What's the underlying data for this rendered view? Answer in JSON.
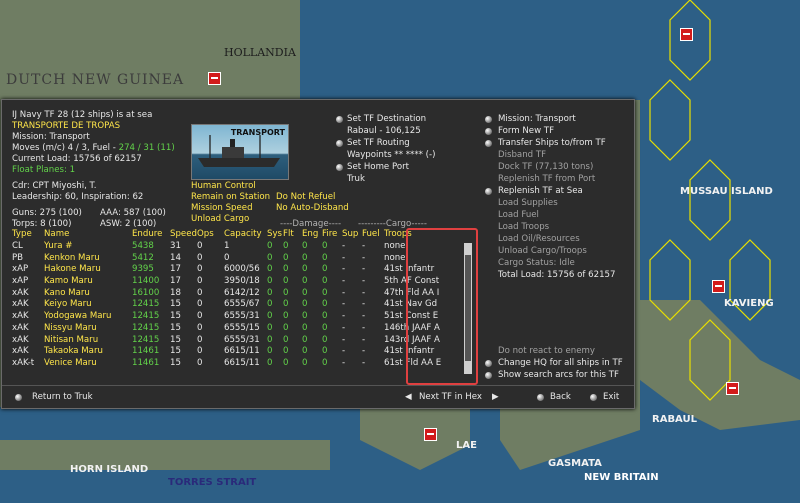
{
  "map": {
    "labels": {
      "hollandia": "HOLLANDIA",
      "dutch_new_guinea": "DUTCH NEW GUINEA",
      "mussau": "MUSSAU ISLAND",
      "kavieng": "KAVIENG",
      "rabaul": "RABAUL",
      "lae": "LAE",
      "gasmata": "GASMATA",
      "new_britain": "NEW BRITAIN",
      "horn_island": "HORN ISLAND",
      "torres_strait": "TORRES STRAIT"
    },
    "colors": {
      "sea": "#2d5f86",
      "land": "#6f7d63",
      "hex_line": "#e8e000",
      "marker": "#d21b1b"
    }
  },
  "tf": {
    "header": "IJ Navy TF 28 (12 ships) is at sea",
    "name": "TRANSPORTE DE TROPAS",
    "mission": "Mission: Transport",
    "moves_prefix": "Moves (m/c)  4 / 3, Fuel - ",
    "moves_fuel": "274 / 31 (11)",
    "current_load": "Current Load: 15756 of 62157",
    "float_planes": "Float Planes: 1",
    "cdr": "Cdr: CPT Miyoshi, T.",
    "leadership": "Leadership: 60, Inspiration: 62",
    "guns": "Guns: 275 (100)",
    "aaa": "AAA: 587 (100)",
    "torps": "Torps: 8 (100)",
    "asw": "ASW: 2 (100)",
    "image_caption": "TRANSPORT",
    "control": {
      "human_control": "Human Control",
      "remain_on_station": "Remain on Station",
      "do_not_refuel": "Do Not Refuel",
      "mission_speed": "Mission Speed",
      "no_auto_disband": "No Auto-Disband",
      "unload_cargo": "Unload Cargo"
    }
  },
  "center_menu": {
    "set_destination": "Set TF Destination",
    "destination_value": "Rabaul - 106,125",
    "set_routing": "Set TF Routing",
    "waypoints": "Waypoints ** **** (-)",
    "set_home_port": "Set Home Port",
    "home_port_value": "Truk"
  },
  "right_menu": {
    "mission": "Mission: Transport",
    "form_new_tf": "Form New TF",
    "transfer_ships": "Transfer Ships to/from TF",
    "disband_tf": "Disband TF",
    "dock_tf": "Dock TF (77,130 tons)",
    "replenish_port": "Replenish TF from Port",
    "replenish_sea": "Replenish TF at Sea",
    "load_supplies": "Load Supplies",
    "load_fuel": "Load Fuel",
    "load_troops": "Load Troops",
    "load_oil": "Load Oil/Resources",
    "unload_cargo": "Unload Cargo/Troops",
    "cargo_status": "Cargo Status: Idle",
    "total_load": "Total Load: 15756 of 62157",
    "do_not_react": "Do not react to enemy",
    "change_hq": "Change HQ for all ships in TF",
    "show_search": "Show search arcs for this TF"
  },
  "table": {
    "group_damage": "----Damage----",
    "group_cargo": "---------Cargo-----",
    "headers": [
      "Type",
      "Name",
      "Endure",
      "Speed",
      "Ops",
      "Capacity",
      "Sys",
      "Flt",
      "Eng",
      "Fire",
      "Sup",
      "Fuel",
      "Troops"
    ],
    "rows": [
      [
        "CL",
        "Yura #",
        "5438",
        "31",
        "0",
        "1",
        "0",
        "0",
        "0",
        "0",
        "-",
        "-",
        "none"
      ],
      [
        "PB",
        "Kenkon Maru",
        "5412",
        "14",
        "0",
        "0",
        "0",
        "0",
        "0",
        "0",
        "-",
        "-",
        "none"
      ],
      [
        "xAP",
        "Hakone Maru",
        "9395",
        "17",
        "0",
        "6000/56",
        "0",
        "0",
        "0",
        "0",
        "-",
        "-",
        "41st Infantr"
      ],
      [
        "xAP",
        "Kamo Maru",
        "11400",
        "17",
        "0",
        "3950/18",
        "0",
        "0",
        "0",
        "0",
        "-",
        "-",
        "5th AF Const"
      ],
      [
        "xAK",
        "Kano Maru",
        "16100",
        "18",
        "0",
        "6142/12",
        "0",
        "0",
        "0",
        "0",
        "-",
        "-",
        "47th Fld AA I"
      ],
      [
        "xAK",
        "Keiyo Maru",
        "12415",
        "15",
        "0",
        "6555/67",
        "0",
        "0",
        "0",
        "0",
        "-",
        "-",
        "41st Nav Gd"
      ],
      [
        "xAK",
        "Yodogawa Maru",
        "12415",
        "15",
        "0",
        "6555/31",
        "0",
        "0",
        "0",
        "0",
        "-",
        "-",
        "51st Const E"
      ],
      [
        "xAK",
        "Nissyu Maru",
        "12415",
        "15",
        "0",
        "6555/15",
        "0",
        "0",
        "0",
        "0",
        "-",
        "-",
        "146th JAAF A"
      ],
      [
        "xAK",
        "Nitisan Maru",
        "12415",
        "15",
        "0",
        "6555/31",
        "0",
        "0",
        "0",
        "0",
        "-",
        "-",
        "143rd JAAF A"
      ],
      [
        "xAK",
        "Takaoka Maru",
        "11461",
        "15",
        "0",
        "6615/11",
        "0",
        "0",
        "0",
        "0",
        "-",
        "-",
        "41st Infantr"
      ],
      [
        "xAK-t",
        "Venice Maru",
        "11461",
        "15",
        "0",
        "6615/11",
        "0",
        "0",
        "0",
        "0",
        "-",
        "-",
        "61st Fld AA E"
      ]
    ]
  },
  "footer": {
    "return": "Return to Truk",
    "next_tf": "Next TF in Hex",
    "back": "Back",
    "exit": "Exit"
  }
}
